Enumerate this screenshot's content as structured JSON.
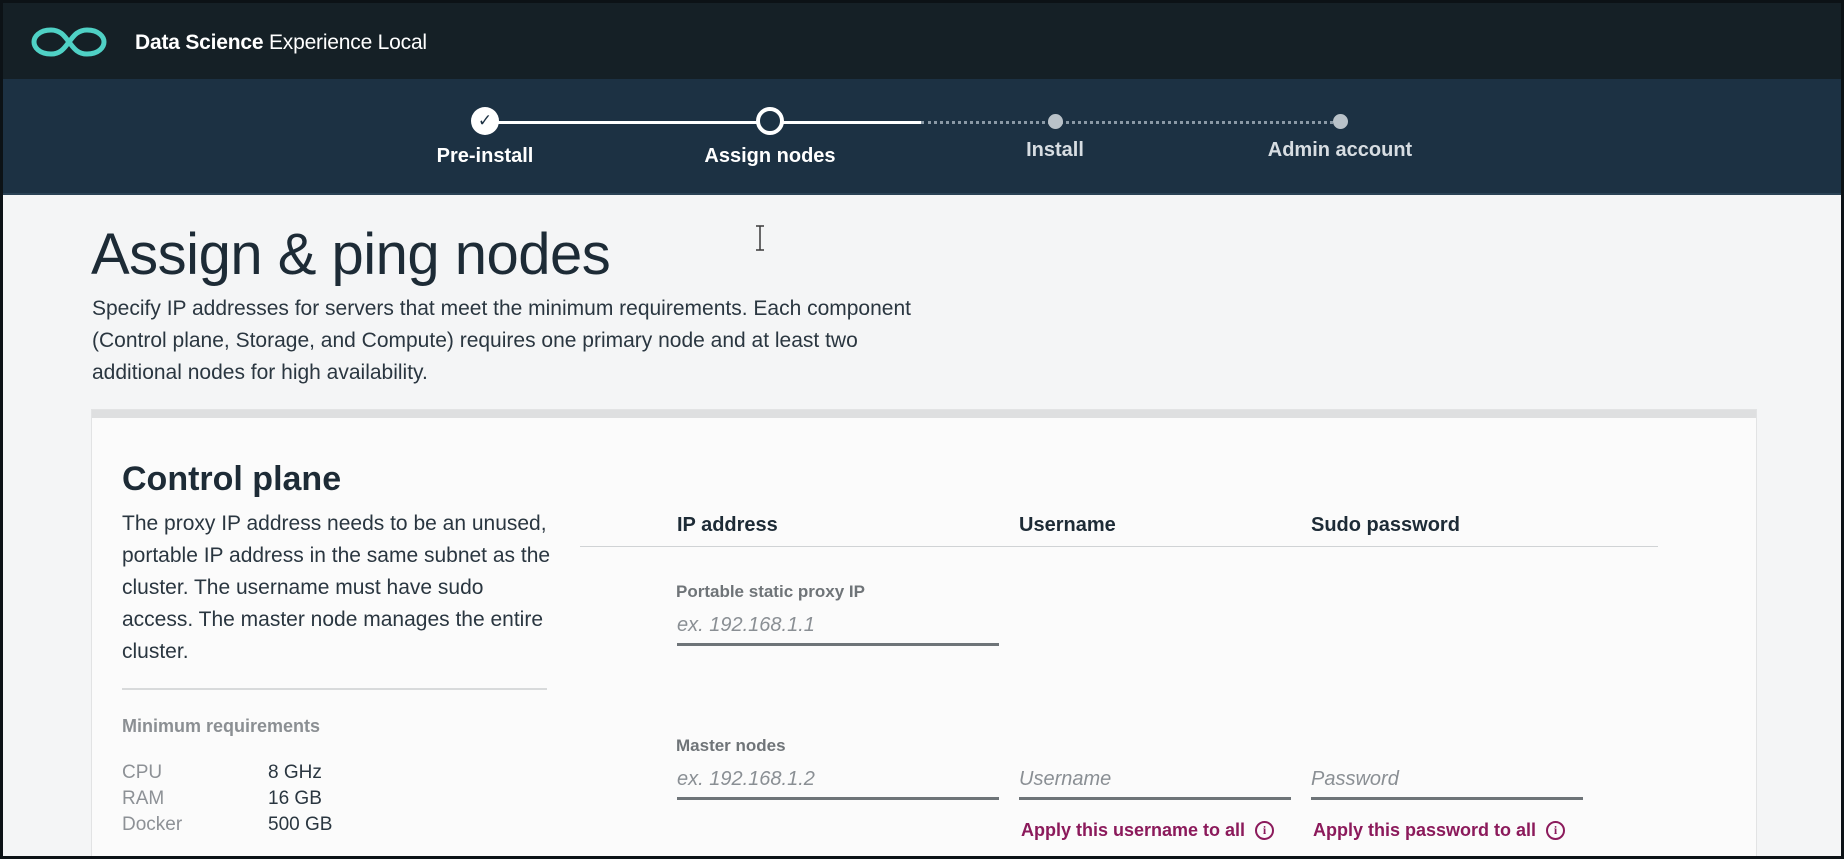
{
  "app": {
    "title_bold": "Data Science",
    "title_light": "Experience Local",
    "brand_color": "#4fd1c5"
  },
  "stepper": {
    "steps": [
      {
        "label": "Pre-install",
        "state": "done"
      },
      {
        "label": "Assign nodes",
        "state": "current"
      },
      {
        "label": "Install",
        "state": "todo"
      },
      {
        "label": "Admin account",
        "state": "todo"
      }
    ]
  },
  "page": {
    "title": "Assign & ping nodes",
    "description": "Specify IP addresses for servers that meet the minimum requirements. Each component (Control plane, Storage, and Compute) requires one primary node and at least two additional nodes for high availability."
  },
  "control_plane": {
    "title": "Control plane",
    "description": "The proxy IP address needs to be an unused, portable IP address in the same subnet as the cluster. The username must have sudo access. The master node manages the entire cluster.",
    "requirements_title": "Minimum requirements",
    "requirements": [
      {
        "key": "CPU",
        "value": "8 GHz"
      },
      {
        "key": "RAM",
        "value": "16 GB"
      },
      {
        "key": "Docker",
        "value": "500 GB"
      }
    ],
    "columns": {
      "ip": "IP address",
      "username": "Username",
      "password": "Sudo password"
    },
    "proxy": {
      "label": "Portable static proxy IP",
      "placeholder": "ex. 192.168.1.1",
      "value": ""
    },
    "master": {
      "label": "Master nodes",
      "ip_placeholder": "ex. 192.168.1.2",
      "username_placeholder": "Username",
      "password_placeholder": "Password",
      "apply_username": "Apply this username to all",
      "apply_password": "Apply this password to all"
    }
  },
  "colors": {
    "topbar": "#152026",
    "stepper": "#1c3143",
    "link": "#8b1a5b"
  }
}
